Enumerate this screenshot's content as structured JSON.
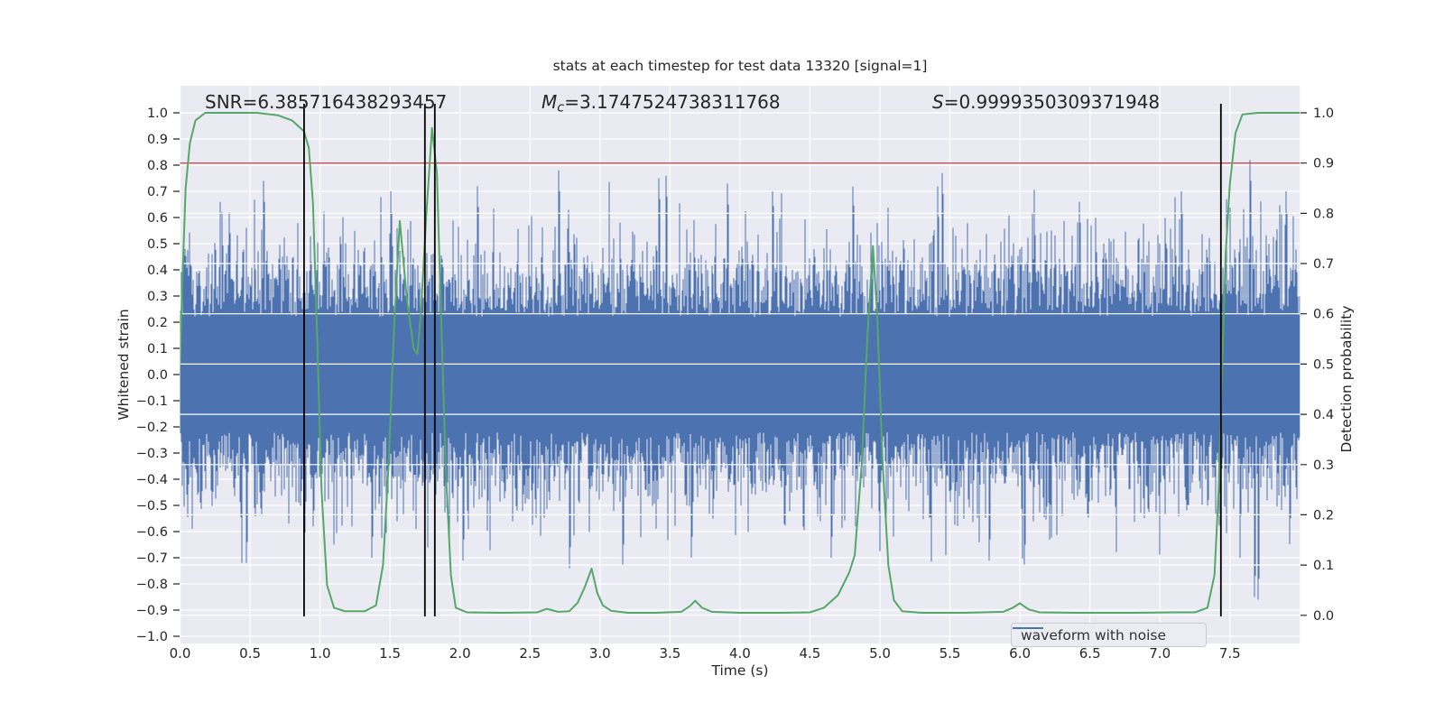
{
  "figure": {
    "title": "stats at each timestep for test data 13320 [signal=1]",
    "xlabel": "Time (s)",
    "ylabel_left": "Whitened strain",
    "ylabel_right": "Detection probability",
    "legend_label": "waveform with noise",
    "annotations": [
      {
        "label": "SNR",
        "sub": "",
        "value": "=6.385716438293457"
      },
      {
        "label": "M",
        "sub": "c",
        "value": "=3.1747524738311768"
      },
      {
        "label": "S",
        "sub": "",
        "value": "=0.9999350309371948"
      }
    ]
  },
  "chart_data": {
    "type": "line",
    "title": "stats at each timestep for test data 13320 [signal=1]",
    "xlabel": "Time (s)",
    "ylabel": "Whitened strain",
    "ylabel_right": "Detection probability",
    "xlim": [
      0,
      8.0
    ],
    "ylim": [
      -1.03,
      1.1
    ],
    "ylim_right": [
      -0.056,
      1.054
    ],
    "grid": true,
    "legend_position": "lower right",
    "x_tick_labels": [
      "0.0",
      "0.5",
      "1.0",
      "1.5",
      "2.0",
      "2.5",
      "3.0",
      "3.5",
      "4.0",
      "4.5",
      "5.0",
      "5.5",
      "6.0",
      "6.5",
      "7.0",
      "7.5"
    ],
    "x_tick_values": [
      0,
      0.5,
      1,
      1.5,
      2,
      2.5,
      3,
      3.5,
      4,
      4.5,
      5,
      5.5,
      6,
      6.5,
      7,
      7.5
    ],
    "y_tick_labels_left": [
      "1.0",
      "0.9",
      "0.8",
      "0.7",
      "0.6",
      "0.5",
      "0.4",
      "0.3",
      "0.2",
      "0.1",
      "0.0",
      "−0.1",
      "−0.2",
      "−0.3",
      "−0.4",
      "−0.5",
      "−0.6",
      "−0.7",
      "−0.8",
      "−0.9",
      "−1.0"
    ],
    "y_tick_values_left": [
      1.0,
      0.9,
      0.8,
      0.7,
      0.6,
      0.5,
      0.4,
      0.3,
      0.2,
      0.1,
      0.0,
      -0.1,
      -0.2,
      -0.3,
      -0.4,
      -0.5,
      -0.6,
      -0.7,
      -0.8,
      -0.9,
      -1.0
    ],
    "y_tick_labels_right": [
      "1.0",
      "0.9",
      "0.8",
      "0.7",
      "0.6",
      "0.5",
      "0.4",
      "0.3",
      "0.2",
      "0.1",
      "0.0"
    ],
    "y_tick_values_right": [
      1.0,
      0.9,
      0.8,
      0.7,
      0.6,
      0.5,
      0.4,
      0.3,
      0.2,
      0.1,
      0.0
    ],
    "colors": {
      "plot_bg": "#eaeaf2",
      "grid": "#ffffff",
      "blue": "#4c72b0",
      "green": "#55a868",
      "red": "#c44e52",
      "black": "#000000",
      "text": "#262626"
    },
    "series": [
      {
        "name": "waveform with noise",
        "style": "noise_band",
        "axis": "left",
        "color": "#4c72b0",
        "seed": 13320,
        "core_halfwidth": 0.22,
        "tail_scale": 0.17,
        "spike_prob": 0.006,
        "notable_spikes_up": [
          [
            0.35,
            0.62
          ],
          [
            0.59,
            0.74
          ],
          [
            1.5,
            0.7
          ],
          [
            2.12,
            0.72
          ],
          [
            2.7,
            0.78
          ],
          [
            3.42,
            0.75
          ],
          [
            3.47,
            0.76
          ],
          [
            3.91,
            0.73
          ],
          [
            4.23,
            0.7
          ],
          [
            5.44,
            0.77
          ],
          [
            6.42,
            0.66
          ],
          [
            7.15,
            0.7
          ],
          [
            7.64,
            0.82
          ],
          [
            7.9,
            0.7
          ]
        ],
        "notable_spikes_down": [
          [
            0.47,
            -0.72
          ],
          [
            1.37,
            -0.7
          ],
          [
            2.02,
            -0.71
          ],
          [
            2.78,
            -0.74
          ],
          [
            3.16,
            -0.73
          ],
          [
            3.65,
            -0.7
          ],
          [
            4.65,
            -0.7
          ],
          [
            5.78,
            -0.71
          ],
          [
            6.03,
            -0.73
          ],
          [
            7.57,
            -0.62
          ],
          [
            7.67,
            -0.85
          ],
          [
            7.7,
            -0.86
          ]
        ]
      },
      {
        "name": "detection probability",
        "style": "line",
        "axis": "right",
        "color": "#55a868",
        "points": [
          [
            0.0,
            0.5
          ],
          [
            0.015,
            0.65
          ],
          [
            0.04,
            0.85
          ],
          [
            0.07,
            0.94
          ],
          [
            0.11,
            0.985
          ],
          [
            0.18,
            1.0
          ],
          [
            0.55,
            1.0
          ],
          [
            0.7,
            0.995
          ],
          [
            0.8,
            0.985
          ],
          [
            0.886,
            0.963
          ],
          [
            0.92,
            0.93
          ],
          [
            0.95,
            0.82
          ],
          [
            0.98,
            0.55
          ],
          [
            1.01,
            0.25
          ],
          [
            1.05,
            0.06
          ],
          [
            1.1,
            0.015
          ],
          [
            1.18,
            0.008
          ],
          [
            1.32,
            0.008
          ],
          [
            1.4,
            0.02
          ],
          [
            1.45,
            0.1
          ],
          [
            1.49,
            0.3
          ],
          [
            1.53,
            0.58
          ],
          [
            1.57,
            0.785
          ],
          [
            1.62,
            0.63
          ],
          [
            1.67,
            0.53
          ],
          [
            1.695,
            0.52
          ],
          [
            1.72,
            0.6
          ],
          [
            1.76,
            0.8
          ],
          [
            1.8,
            0.97
          ],
          [
            1.835,
            0.88
          ],
          [
            1.87,
            0.55
          ],
          [
            1.9,
            0.28
          ],
          [
            1.935,
            0.08
          ],
          [
            1.97,
            0.015
          ],
          [
            2.05,
            0.006
          ],
          [
            2.3,
            0.005
          ],
          [
            2.55,
            0.006
          ],
          [
            2.62,
            0.013
          ],
          [
            2.7,
            0.007
          ],
          [
            2.78,
            0.008
          ],
          [
            2.84,
            0.025
          ],
          [
            2.89,
            0.055
          ],
          [
            2.94,
            0.093
          ],
          [
            2.98,
            0.045
          ],
          [
            3.02,
            0.02
          ],
          [
            3.08,
            0.009
          ],
          [
            3.2,
            0.005
          ],
          [
            3.4,
            0.005
          ],
          [
            3.58,
            0.007
          ],
          [
            3.64,
            0.018
          ],
          [
            3.68,
            0.029
          ],
          [
            3.73,
            0.015
          ],
          [
            3.8,
            0.007
          ],
          [
            4.0,
            0.005
          ],
          [
            4.3,
            0.005
          ],
          [
            4.5,
            0.006
          ],
          [
            4.6,
            0.015
          ],
          [
            4.7,
            0.04
          ],
          [
            4.78,
            0.085
          ],
          [
            4.82,
            0.12
          ],
          [
            4.87,
            0.3
          ],
          [
            4.91,
            0.55
          ],
          [
            4.95,
            0.735
          ],
          [
            4.98,
            0.6
          ],
          [
            5.02,
            0.3
          ],
          [
            5.06,
            0.1
          ],
          [
            5.1,
            0.03
          ],
          [
            5.16,
            0.008
          ],
          [
            5.3,
            0.005
          ],
          [
            5.6,
            0.005
          ],
          [
            5.88,
            0.007
          ],
          [
            5.95,
            0.015
          ],
          [
            6.0,
            0.024
          ],
          [
            6.06,
            0.012
          ],
          [
            6.14,
            0.006
          ],
          [
            6.4,
            0.005
          ],
          [
            6.8,
            0.005
          ],
          [
            7.1,
            0.006
          ],
          [
            7.25,
            0.006
          ],
          [
            7.34,
            0.015
          ],
          [
            7.39,
            0.08
          ],
          [
            7.42,
            0.25
          ],
          [
            7.445,
            0.5
          ],
          [
            7.47,
            0.72
          ],
          [
            7.5,
            0.86
          ],
          [
            7.54,
            0.96
          ],
          [
            7.59,
            0.997
          ],
          [
            7.7,
            1.0
          ],
          [
            8.0,
            1.0
          ]
        ]
      },
      {
        "name": "detection threshold",
        "style": "hline",
        "axis": "right",
        "color": "#c44e52",
        "y": 0.9
      },
      {
        "name": "event markers",
        "style": "vlines",
        "color": "#000000",
        "x": [
          0.886,
          1.749,
          1.82,
          7.436
        ]
      }
    ]
  }
}
